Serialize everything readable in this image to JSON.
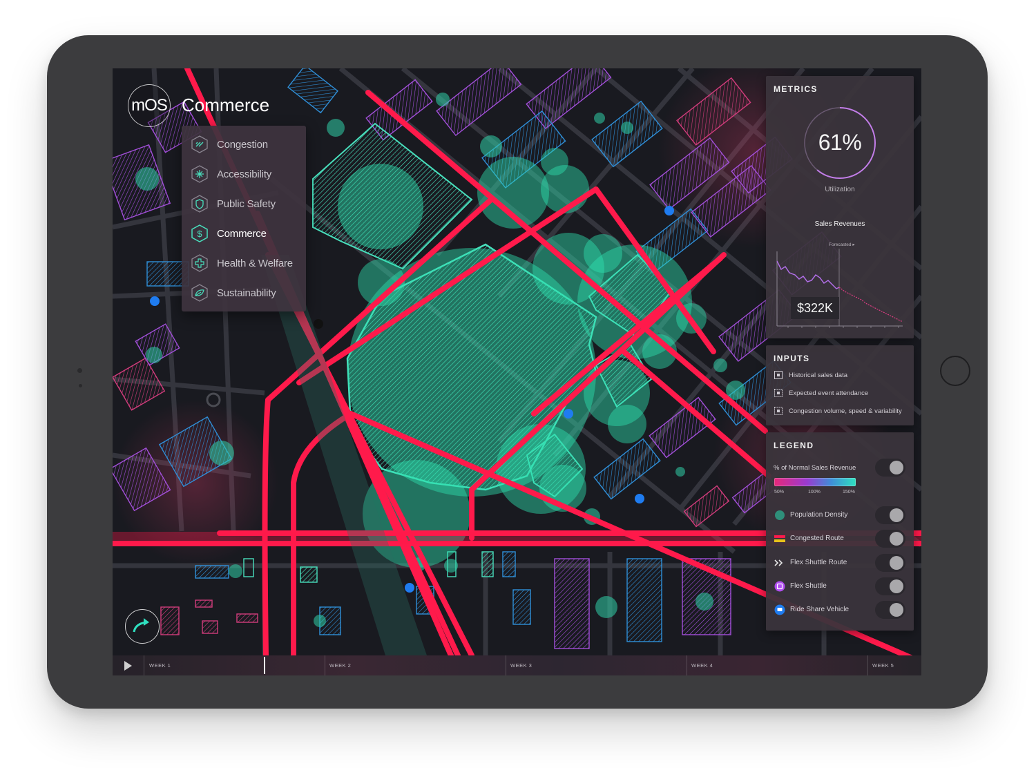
{
  "app": {
    "logo_text": "mOS",
    "title": "Commerce"
  },
  "menu": {
    "items": [
      {
        "label": "Congestion",
        "icon": "congestion-icon"
      },
      {
        "label": "Accessibility",
        "icon": "accessibility-icon"
      },
      {
        "label": "Public Safety",
        "icon": "shield-icon"
      },
      {
        "label": "Commerce",
        "icon": "dollar-icon",
        "active": true
      },
      {
        "label": "Health & Welfare",
        "icon": "cross-icon"
      },
      {
        "label": "Sustainability",
        "icon": "leaf-icon"
      }
    ]
  },
  "metrics": {
    "title": "METRICS",
    "utilization_value": "61%",
    "utilization_fraction": 0.61,
    "utilization_label": "Utilization",
    "sales_title": "Sales Revenues",
    "forecast_label": "Forecasted ▸",
    "sales_value": "$322K"
  },
  "inputs": {
    "title": "INPUTS",
    "items": [
      "Historical sales data",
      "Expected event attendance",
      "Congestion volume, speed & variability"
    ]
  },
  "legend": {
    "title": "LEGEND",
    "revenue_title": "% of Normal Sales Revenue",
    "revenue_ticks": [
      "50%",
      "100%",
      "150%"
    ],
    "items": [
      {
        "label": "Population Density",
        "icon": "population-density-icon"
      },
      {
        "label": "Congested Route",
        "icon": "congested-route-icon"
      },
      {
        "label": "Flex Shuttle Route",
        "icon": "chevrons-icon"
      },
      {
        "label": "Flex Shuttle",
        "icon": "flex-shuttle-icon"
      },
      {
        "label": "Ride Share Vehicle",
        "icon": "ride-share-icon"
      }
    ],
    "toggles_on": [
      true,
      true,
      true,
      true,
      true,
      true
    ]
  },
  "timeline": {
    "weeks": [
      "WEEK 1",
      "WEEK 2",
      "WEEK 3",
      "WEEK 4",
      "WEEK 5"
    ]
  },
  "colors": {
    "route": "#ff1a4b",
    "density": "#2fe0b0",
    "building_purple": "#8a3fc9",
    "building_blue": "#2f8fd8",
    "accent": "#b07be0"
  }
}
